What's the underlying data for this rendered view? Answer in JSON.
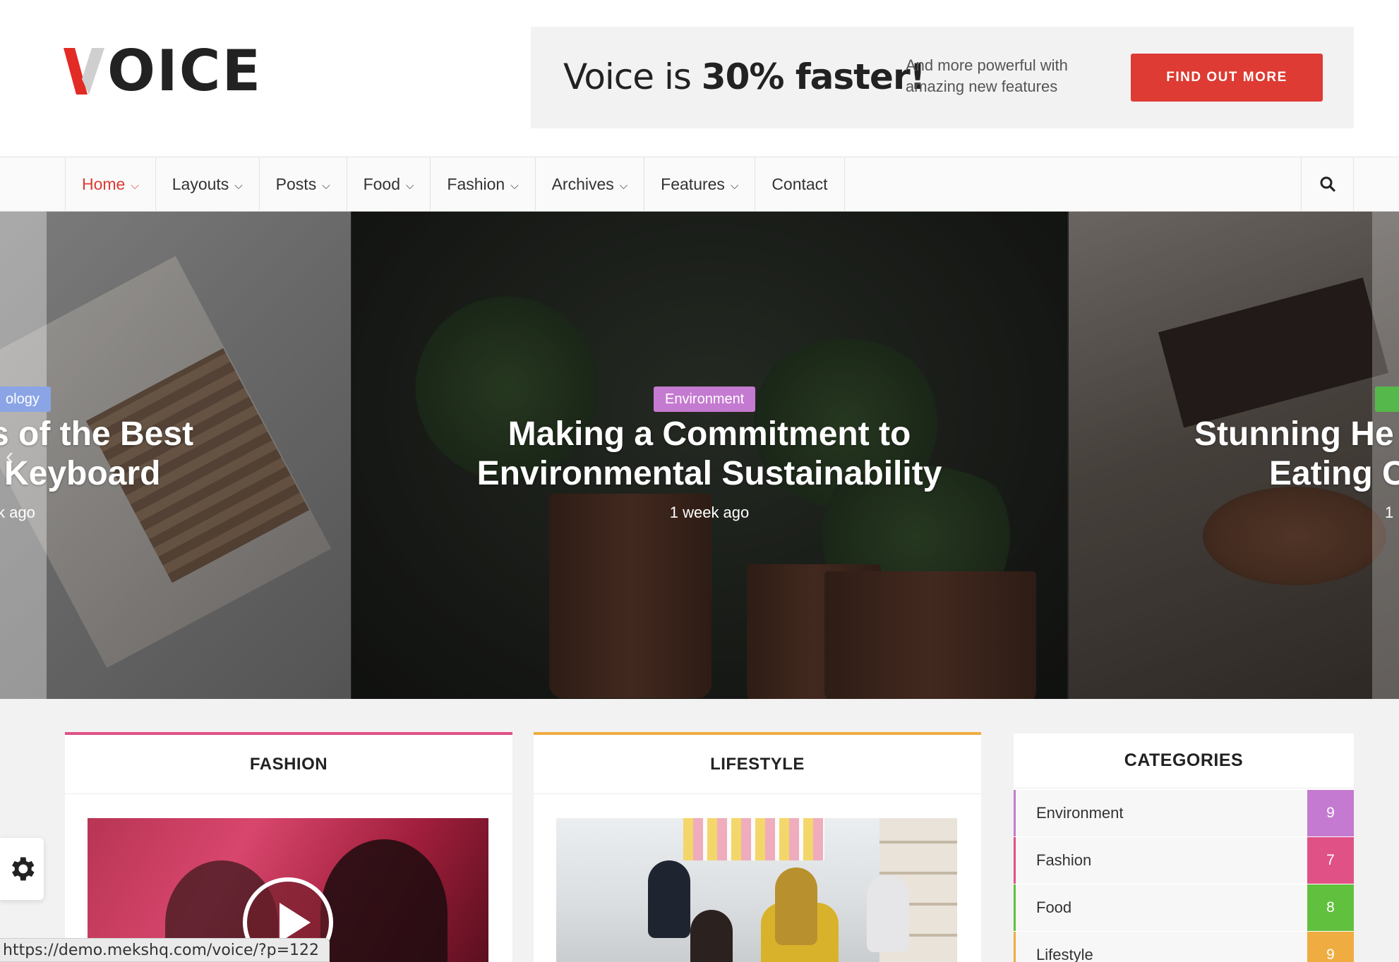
{
  "header": {
    "logo_text": "OICE",
    "logo_full": "VOICE",
    "ad": {
      "headline_pre": "Voice is ",
      "headline_bold": "30% faster!",
      "subtext": "And more powerful with amazing new features",
      "button_label": "FIND OUT MORE",
      "button_color": "#dd3b33"
    }
  },
  "nav": {
    "items": [
      {
        "label": "Home",
        "dropdown": true,
        "active": true
      },
      {
        "label": "Layouts",
        "dropdown": true
      },
      {
        "label": "Posts",
        "dropdown": true
      },
      {
        "label": "Food",
        "dropdown": true
      },
      {
        "label": "Fashion",
        "dropdown": true
      },
      {
        "label": "Archives",
        "dropdown": true
      },
      {
        "label": "Features",
        "dropdown": true
      },
      {
        "label": "Contact",
        "dropdown": false
      }
    ],
    "search_icon": "search-icon",
    "accent_color": "#dd3b33"
  },
  "slider": {
    "slides": [
      {
        "category": "ology",
        "category_color": "#8aa4e6",
        "title_line1": "s of the Best",
        "title_line2": "Keyboard",
        "meta": "k ago"
      },
      {
        "category": "Environment",
        "category_color": "#c47ad0",
        "title_line1": "Making a Commitment to",
        "title_line2": "Environmental Sustainability",
        "meta": "1 week ago"
      },
      {
        "category": "",
        "category_color": "#55b84a",
        "title_line1": "Stunning He",
        "title_line2": "Eating C",
        "meta": "1"
      }
    ]
  },
  "widgets": {
    "fashion": {
      "title": "FASHION",
      "accent": "#e05185",
      "has_video": true
    },
    "lifestyle": {
      "title": "LIFESTYLE",
      "accent": "#efac40"
    },
    "categories": {
      "title": "CATEGORIES",
      "items": [
        {
          "name": "Environment",
          "count": "9",
          "color": "#c47ad0"
        },
        {
          "name": "Fashion",
          "count": "7",
          "color": "#e05185"
        },
        {
          "name": "Food",
          "count": "8",
          "color": "#62c03f"
        },
        {
          "name": "Lifestyle",
          "count": "9",
          "color": "#efac40"
        }
      ]
    }
  },
  "floating": {
    "settings_icon": "gear-icon",
    "status_url": "https://demo.mekshq.com/voice/?p=122"
  }
}
